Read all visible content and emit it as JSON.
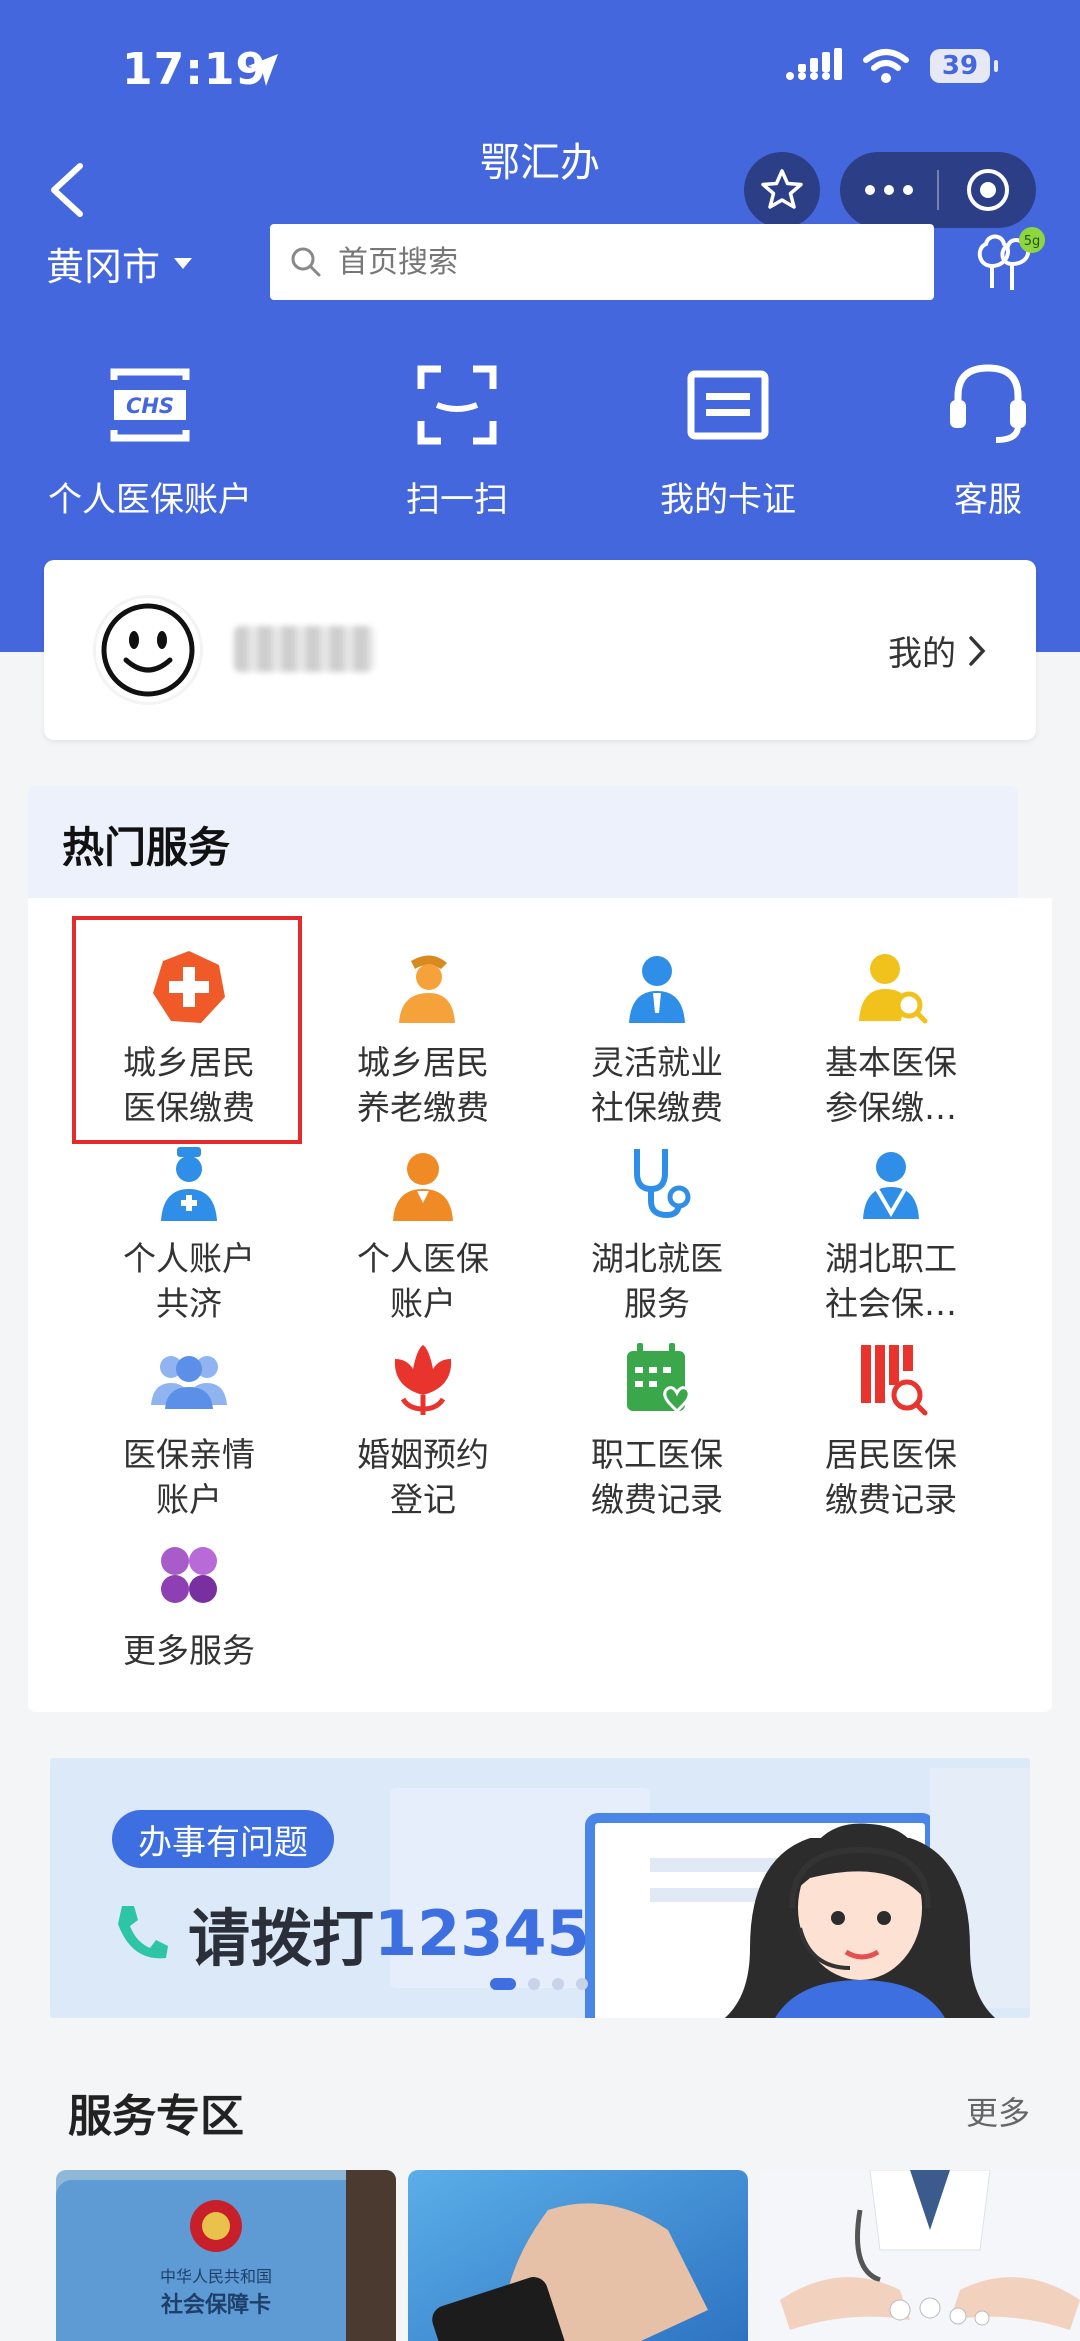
{
  "status_bar": {
    "time": "17:19",
    "battery": "39"
  },
  "nav": {
    "title": "鄂汇办"
  },
  "location": {
    "city": "黄冈市"
  },
  "search": {
    "placeholder": "首页搜索"
  },
  "badge": {
    "tree_badge": "5g"
  },
  "quick_actions": [
    {
      "label": "个人医保账户",
      "icon": "chs-card-icon"
    },
    {
      "label": "扫一扫",
      "icon": "scan-icon"
    },
    {
      "label": "我的卡证",
      "icon": "id-card-icon"
    },
    {
      "label": "客服",
      "icon": "headset-icon"
    }
  ],
  "user": {
    "mine_label": "我的"
  },
  "hot_services": {
    "title": "热门服务",
    "items": [
      {
        "line1": "城乡居民",
        "line2": "医保缴费",
        "icon": "medical-cross-icon",
        "color": "#f05a28"
      },
      {
        "line1": "城乡居民",
        "line2": "养老缴费",
        "icon": "elder-icon",
        "color": "#f5a23a"
      },
      {
        "line1": "灵活就业",
        "line2": "社保缴费",
        "icon": "worker-icon",
        "color": "#2f8fe8"
      },
      {
        "line1": "基本医保",
        "line2": "参保缴…",
        "icon": "person-search-icon",
        "color": "#f2c21c"
      },
      {
        "line1": "个人账户",
        "line2": "共济",
        "icon": "doctor-icon",
        "color": "#2f8fe8"
      },
      {
        "line1": "个人医保",
        "line2": "账户",
        "icon": "person-icon",
        "color": "#f08a24"
      },
      {
        "line1": "湖北就医",
        "line2": "服务",
        "icon": "stethoscope-icon",
        "color": "#2f8fe8"
      },
      {
        "line1": "湖北职工",
        "line2": "社会保…",
        "icon": "employee-icon",
        "color": "#2f8fe8"
      },
      {
        "line1": "医保亲情",
        "line2": "账户",
        "icon": "family-icon",
        "color": "#5b8fe8"
      },
      {
        "line1": "婚姻预约",
        "line2": "登记",
        "icon": "flower-icon",
        "color": "#e8342c"
      },
      {
        "line1": "职工医保",
        "line2": "缴费记录",
        "icon": "calendar-icon",
        "color": "#3aa84a"
      },
      {
        "line1": "居民医保",
        "line2": "缴费记录",
        "icon": "record-search-icon",
        "color": "#e8342c"
      },
      {
        "line1": "更多服务",
        "line2": "",
        "icon": "more-services-icon",
        "color": "#8e3fb4"
      }
    ]
  },
  "banner": {
    "tag": "办事有问题",
    "text_prefix": "请拨打",
    "number": "12345"
  },
  "service_zone": {
    "title": "服务专区",
    "more": "更多",
    "card_text": [
      "中华人民共和国",
      "社会保障卡"
    ]
  }
}
